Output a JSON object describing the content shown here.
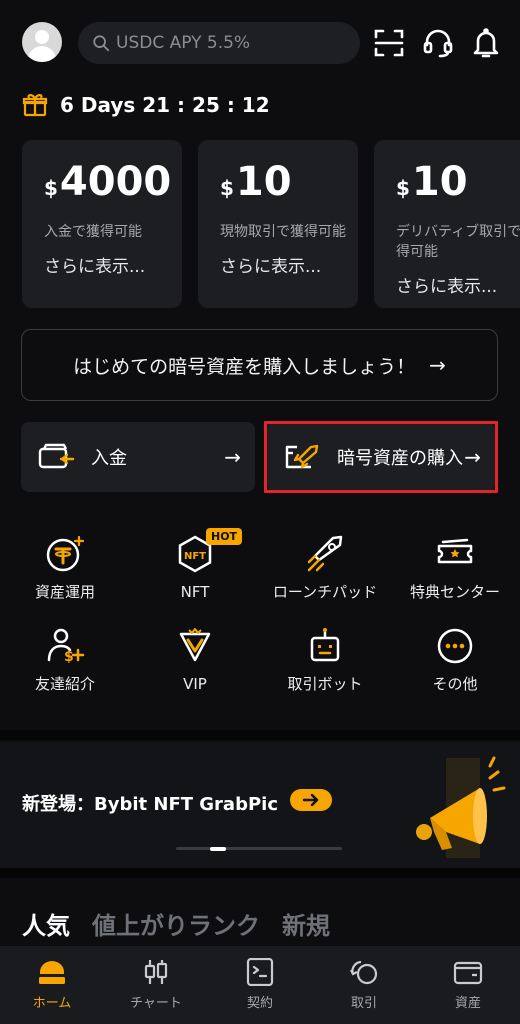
{
  "header": {
    "search_placeholder": "USDC APY 5.5%",
    "icons": [
      "avatar",
      "scan-icon",
      "support-icon",
      "bell-icon"
    ]
  },
  "countdown": {
    "text": "6 Days 21 : 25 : 12",
    "icon": "gift-icon"
  },
  "reward_cards": [
    {
      "currency": "$",
      "amount": "4000",
      "desc": "入金で獲得可能",
      "more": "さらに表示..."
    },
    {
      "currency": "$",
      "amount": "10",
      "desc": "現物取引で獲得可能",
      "more": "さらに表示..."
    },
    {
      "currency": "$",
      "amount": "10",
      "desc": "デリバティブ取引で獲得可能",
      "more": "さらに表示..."
    }
  ],
  "buy_banner": {
    "label": "はじめての暗号資産を購入しましょう！",
    "arrow": "→"
  },
  "actions": {
    "deposit": {
      "label": "入金",
      "arrow": "→"
    },
    "buy_crypto": {
      "label": "暗号資産の購入",
      "arrow": "→"
    }
  },
  "features": [
    {
      "label": "資産運用"
    },
    {
      "label": "NFT"
    },
    {
      "label": "ローンチパッド"
    },
    {
      "label": "特典センター"
    },
    {
      "label": "友達紹介"
    },
    {
      "label": "VIP"
    },
    {
      "label": "取引ボット"
    },
    {
      "label": "その他"
    }
  ],
  "hot_badge": "HOT",
  "promo": {
    "text": "新登場：Bybit NFT GrabPic",
    "arrow": "→"
  },
  "tabs": [
    {
      "label": "人気",
      "active": true
    },
    {
      "label": "値上がりランク",
      "active": false
    },
    {
      "label": "新規",
      "active": false
    }
  ],
  "nav": [
    {
      "label": "ホーム",
      "active": true
    },
    {
      "label": "チャート",
      "active": false
    },
    {
      "label": "契約",
      "active": false
    },
    {
      "label": "取引",
      "active": false
    },
    {
      "label": "資産",
      "active": false
    }
  ],
  "colors": {
    "accent": "#f7a600",
    "highlight": "#e3242b",
    "bg": "#0d0d0f",
    "card": "#1d1e22"
  }
}
